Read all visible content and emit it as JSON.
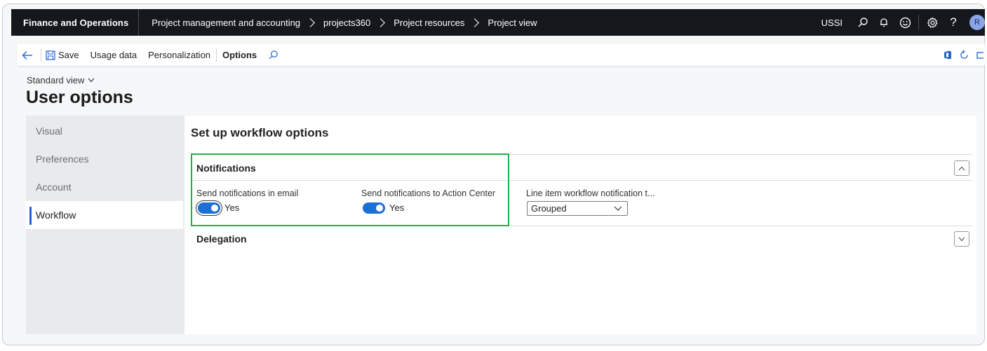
{
  "topbar": {
    "app_name": "Finance and Operations",
    "breadcrumbs": [
      "Project management and accounting",
      "projects360",
      "Project resources",
      "Project view"
    ],
    "company": "USSI",
    "avatar_initial": "R",
    "icons": [
      "search-icon",
      "bell-icon",
      "smiley-icon",
      "gear-icon",
      "help-icon"
    ]
  },
  "actionbar": {
    "save_label": "Save",
    "usage_data_label": "Usage data",
    "personalization_label": "Personalization",
    "options_label": "Options"
  },
  "header": {
    "view_selector": "Standard view",
    "title": "User options"
  },
  "leftnav": {
    "items": [
      {
        "label": "Visual"
      },
      {
        "label": "Preferences"
      },
      {
        "label": "Account"
      },
      {
        "label": "Workflow"
      }
    ],
    "active": "Workflow"
  },
  "content": {
    "section_title": "Set up workflow options",
    "notifications": {
      "header": "Notifications",
      "email_label": "Send notifications in email",
      "email_value": "Yes",
      "action_center_label": "Send notifications to Action Center",
      "action_center_value": "Yes",
      "line_item_label": "Line item workflow notification t...",
      "line_item_value": "Grouped"
    },
    "delegation": {
      "header": "Delegation"
    }
  },
  "colors": {
    "topbar_bg": "#14181c",
    "accent": "#1b6fd6",
    "highlight": "#22b04b"
  }
}
